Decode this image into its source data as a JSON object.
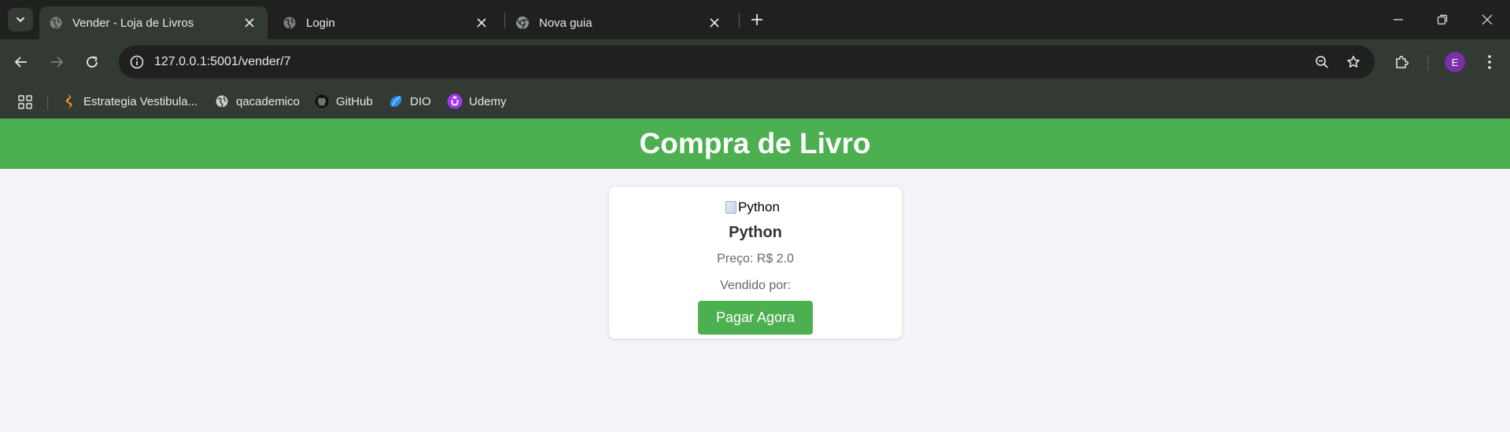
{
  "browser": {
    "tabs": [
      {
        "title": "Vender - Loja de Livros",
        "active": true,
        "icon": "globe-icon"
      },
      {
        "title": "Login",
        "active": false,
        "icon": "globe-icon"
      },
      {
        "title": "Nova guia",
        "active": false,
        "icon": "chrome-icon"
      }
    ],
    "url": "127.0.0.1:5001/vender/7",
    "profile_initial": "E",
    "bookmarks": [
      {
        "label": "Estrategia Vestibula...",
        "icon": "estrategia-icon"
      },
      {
        "label": "qacademico",
        "icon": "globe-icon"
      },
      {
        "label": "GitHub",
        "icon": "github-icon"
      },
      {
        "label": "DIO",
        "icon": "dio-icon"
      },
      {
        "label": "Udemy",
        "icon": "udemy-icon"
      }
    ]
  },
  "page": {
    "title": "Compra de Livro",
    "book": {
      "image_alt": "Python",
      "name": "Python",
      "price": "Preço: R$ 2.0",
      "seller": "Vendido por:"
    },
    "pay_button": "Pagar Agora"
  },
  "colors": {
    "brand_green": "#4caf50",
    "browser_frame": "#1e211e",
    "browser_toolbar": "#333933",
    "page_bg": "#f4f4f8",
    "avatar": "#7b2fa8"
  }
}
